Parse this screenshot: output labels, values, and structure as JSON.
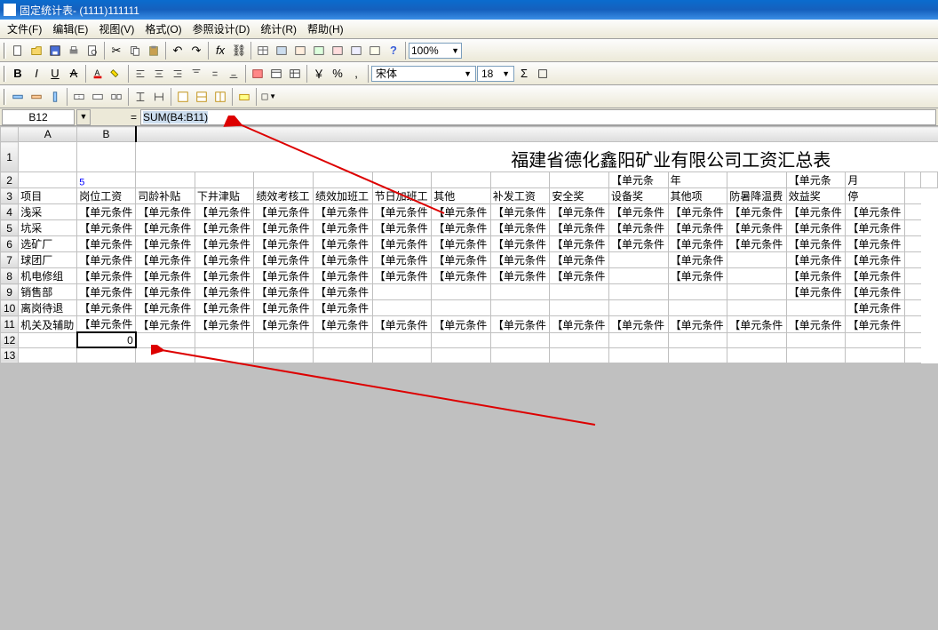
{
  "window": {
    "title": "固定统计表- (1111)111111"
  },
  "menu": {
    "file": "文件(F)",
    "edit": "编辑(E)",
    "view": "视图(V)",
    "format": "格式(O)",
    "refdesign": "参照设计(D)",
    "stats": "统计(R)",
    "help": "帮助(H)"
  },
  "toolbar": {
    "zoom": "100%",
    "font": "宋体",
    "fontsize": "18",
    "bold": "B",
    "italic": "I",
    "underline": "U",
    "strike": "A"
  },
  "formula": {
    "cellref": "B12",
    "eq": "=",
    "value": "SUM(B4:B11)"
  },
  "sheet": {
    "title_text": "福建省德化鑫阳矿业有限公司工资汇总表",
    "blue5": "5",
    "row2_K": "【单元条",
    "row2_L": "年",
    "row2_N": "【单元条",
    "row2_O": "月",
    "r3": {
      "A": "项目",
      "B": "岗位工资",
      "C": "司龄补贴",
      "D": "下井津贴",
      "E": "绩效考核工",
      "F": "绩效加班工",
      "G": "节日加班工",
      "H": "其他",
      "I": "补发工资",
      "J": "安全奖",
      "K": "设备奖",
      "L": "其他项",
      "M": "防暑降温费",
      "N": "效益奖",
      "O": "停"
    },
    "rows_label": [
      "浅采",
      "坑采",
      "选矿厂",
      "球团厂",
      "机电修组",
      "销售部",
      "离岗待退",
      "机关及辅助"
    ],
    "cellcond": "【单元条件",
    "b12": "0"
  }
}
